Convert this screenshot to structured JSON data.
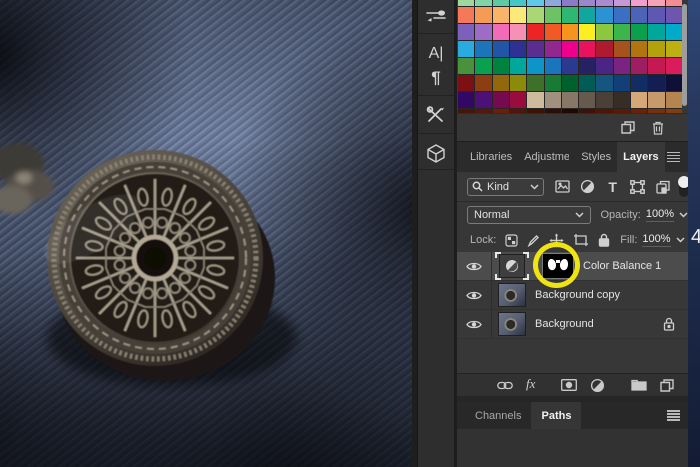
{
  "left_rail": {
    "icons": [
      "brushes-panel",
      "character-panel",
      "paragraph-panel",
      "tool-presets-panel",
      "3d-panel"
    ],
    "character_glyph": "A|",
    "paragraph_glyph": "¶"
  },
  "swatches_panel": {
    "rows": [
      [
        "#9fd89f",
        "#7fd4a8",
        "#5ec9a4",
        "#46c6c6",
        "#5fc8e8",
        "#8fa8dc",
        "#8b7ac8",
        "#9b87ce",
        "#ab8bd0",
        "#c699d6",
        "#f0a0cc",
        "#f7a3b7",
        "#f28e93"
      ],
      [
        "#f4785a",
        "#f59b55",
        "#f8b56a",
        "#fbe97a",
        "#a8d773",
        "#6cc366",
        "#2eb673",
        "#12a79e",
        "#2b93d2",
        "#3b6fc4",
        "#4d63b8",
        "#5e58b2",
        "#6e55ae"
      ],
      [
        "#7b60be",
        "#9c6cc6",
        "#f16cb8",
        "#f591b5",
        "#ec2426",
        "#f15a24",
        "#f7941e",
        "#fcee21",
        "#8dc63f",
        "#3cb54a",
        "#0ba04e",
        "#00a89c",
        "#00aac8"
      ],
      [
        "#29abe2",
        "#1c75bc",
        "#2156a6",
        "#2e3192",
        "#5b2d90",
        "#92278f",
        "#ec008c",
        "#e8125d",
        "#ae1a2e",
        "#a5531b",
        "#b0750e",
        "#b2a30c",
        "#bdb012"
      ],
      [
        "#49913c",
        "#0ba04e",
        "#00833f",
        "#00a79b",
        "#0d94c8",
        "#1b75bc",
        "#2a3b8f",
        "#262262",
        "#4b2583",
        "#7b2382",
        "#9e1e63",
        "#c41952",
        "#da1c5c"
      ],
      [
        "#7d1012",
        "#8c3e10",
        "#93670b",
        "#8b8b09",
        "#3f7029",
        "#197a34",
        "#00612f",
        "#005c55",
        "#14567e",
        "#123f78",
        "#102e63",
        "#131f52",
        "#0e1038"
      ],
      [
        "#310863",
        "#4c1076",
        "#750a4e",
        "#9a0c3c",
        "#cdbb9e",
        "#a2907e",
        "#887767",
        "#665a4e",
        "#4b4038",
        "#352d26",
        "#d6a877",
        "#c69a6a",
        "#b5854f"
      ],
      [
        "#4a1408",
        "#581808",
        "#6b1e08",
        "#511605",
        "#3f1204",
        "#2e0d03",
        "#1f0902",
        "#401106",
        "#511505",
        "#5e1905",
        "#6b2007",
        "#77300c",
        "#833c10"
      ]
    ]
  },
  "layers_panel": {
    "tabs": [
      {
        "label": "Libraries",
        "active": false
      },
      {
        "label": "Adjustme",
        "active": false
      },
      {
        "label": "Styles",
        "active": false
      },
      {
        "label": "Layers",
        "active": true
      }
    ],
    "filter": {
      "value": "Kind"
    },
    "blend": {
      "mode": "Normal",
      "opacity_label": "Opacity:",
      "opacity_value": "100%"
    },
    "lock": {
      "label": "Lock:",
      "fill_label": "Fill:",
      "fill_value": "100%"
    },
    "layers": [
      {
        "name": "Color Balance 1",
        "kind": "adjustment",
        "selected": true,
        "has_mask": true,
        "locked": false
      },
      {
        "name": "Background copy",
        "kind": "image",
        "selected": false,
        "has_mask": false,
        "locked": false
      },
      {
        "name": "Background",
        "kind": "image",
        "selected": false,
        "has_mask": false,
        "locked": true
      }
    ]
  },
  "bottom_panel": {
    "tabs": [
      {
        "label": "Channels",
        "active": false
      },
      {
        "label": "Paths",
        "active": true
      }
    ]
  },
  "annotation": {
    "type": "highlight-circle",
    "color": "#efe412",
    "target": "color-balance-layer-mask-thumbnail"
  },
  "page_edge": {
    "digit": "4"
  }
}
